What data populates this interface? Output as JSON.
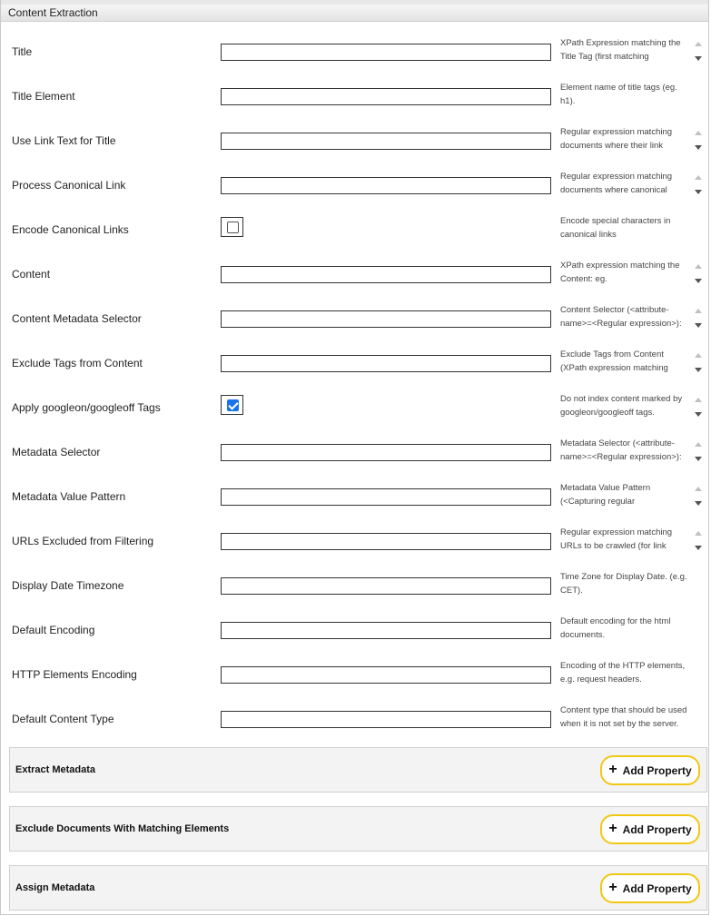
{
  "panel": {
    "title": "Content Extraction"
  },
  "fields": [
    {
      "label": "Title",
      "type": "text",
      "value": "",
      "help": "XPath Expression matching the Title Tag (first matching",
      "scroll": true
    },
    {
      "label": "Title Element",
      "type": "text",
      "value": "",
      "help": "Element name of title tags (eg. h1).",
      "scroll": false
    },
    {
      "label": "Use Link Text for Title",
      "type": "text",
      "value": "",
      "help": "Regular expression matching documents where their link",
      "scroll": true
    },
    {
      "label": "Process Canonical Link",
      "type": "text",
      "value": "",
      "help": "Regular expression matching documents where canonical",
      "scroll": true
    },
    {
      "label": "Encode Canonical Links",
      "type": "checkbox",
      "checked": false,
      "help": "Encode special characters in canonical links",
      "scroll": false
    },
    {
      "label": "Content",
      "type": "text",
      "value": "",
      "help": "XPath expression matching the Content: eg.",
      "scroll": true
    },
    {
      "label": "Content Metadata Selector",
      "type": "text",
      "value": "",
      "help": "Content Selector (<attribute-name>=<Regular expression>):",
      "scroll": true
    },
    {
      "label": "Exclude Tags from Content",
      "type": "text",
      "value": "",
      "help": "Exclude Tags from Content (XPath expression matching",
      "scroll": true
    },
    {
      "label": "Apply googleon/googleoff Tags",
      "type": "checkbox",
      "checked": true,
      "help": "Do not index content marked by googleon/googleoff tags.",
      "scroll": true
    },
    {
      "label": "Metadata Selector",
      "type": "text",
      "value": "",
      "help": "Metadata Selector (<attribute-name>=<Regular expression>):",
      "scroll": true
    },
    {
      "label": "Metadata Value Pattern",
      "type": "text",
      "value": "",
      "help": "Metadata Value Pattern (<Capturing regular",
      "scroll": true
    },
    {
      "label": "URLs Excluded from Filtering",
      "type": "text",
      "value": "",
      "help": "Regular expression matching URLs to be crawled (for link",
      "scroll": true
    },
    {
      "label": "Display Date Timezone",
      "type": "text",
      "value": "",
      "help": "Time Zone for Display Date. (e.g. CET).",
      "scroll": false
    },
    {
      "label": "Default Encoding",
      "type": "text",
      "value": "",
      "help": "Default encoding for the html documents.",
      "scroll": false
    },
    {
      "label": "HTTP Elements Encoding",
      "type": "text",
      "value": "",
      "help": "Encoding of the HTTP elements, e.g. request headers.",
      "scroll": false
    },
    {
      "label": "Default Content Type",
      "type": "text",
      "value": "",
      "help": "Content type that should be used when it is not set by the server.",
      "scroll": false
    }
  ],
  "sections": [
    {
      "title": "Extract Metadata",
      "button": "Add Property"
    },
    {
      "title": "Exclude Documents With Matching Elements",
      "button": "Add Property"
    },
    {
      "title": "Assign Metadata",
      "button": "Add Property"
    }
  ],
  "colors": {
    "button_border": "#f2c713",
    "checkbox_checked": "#1a73e8"
  }
}
